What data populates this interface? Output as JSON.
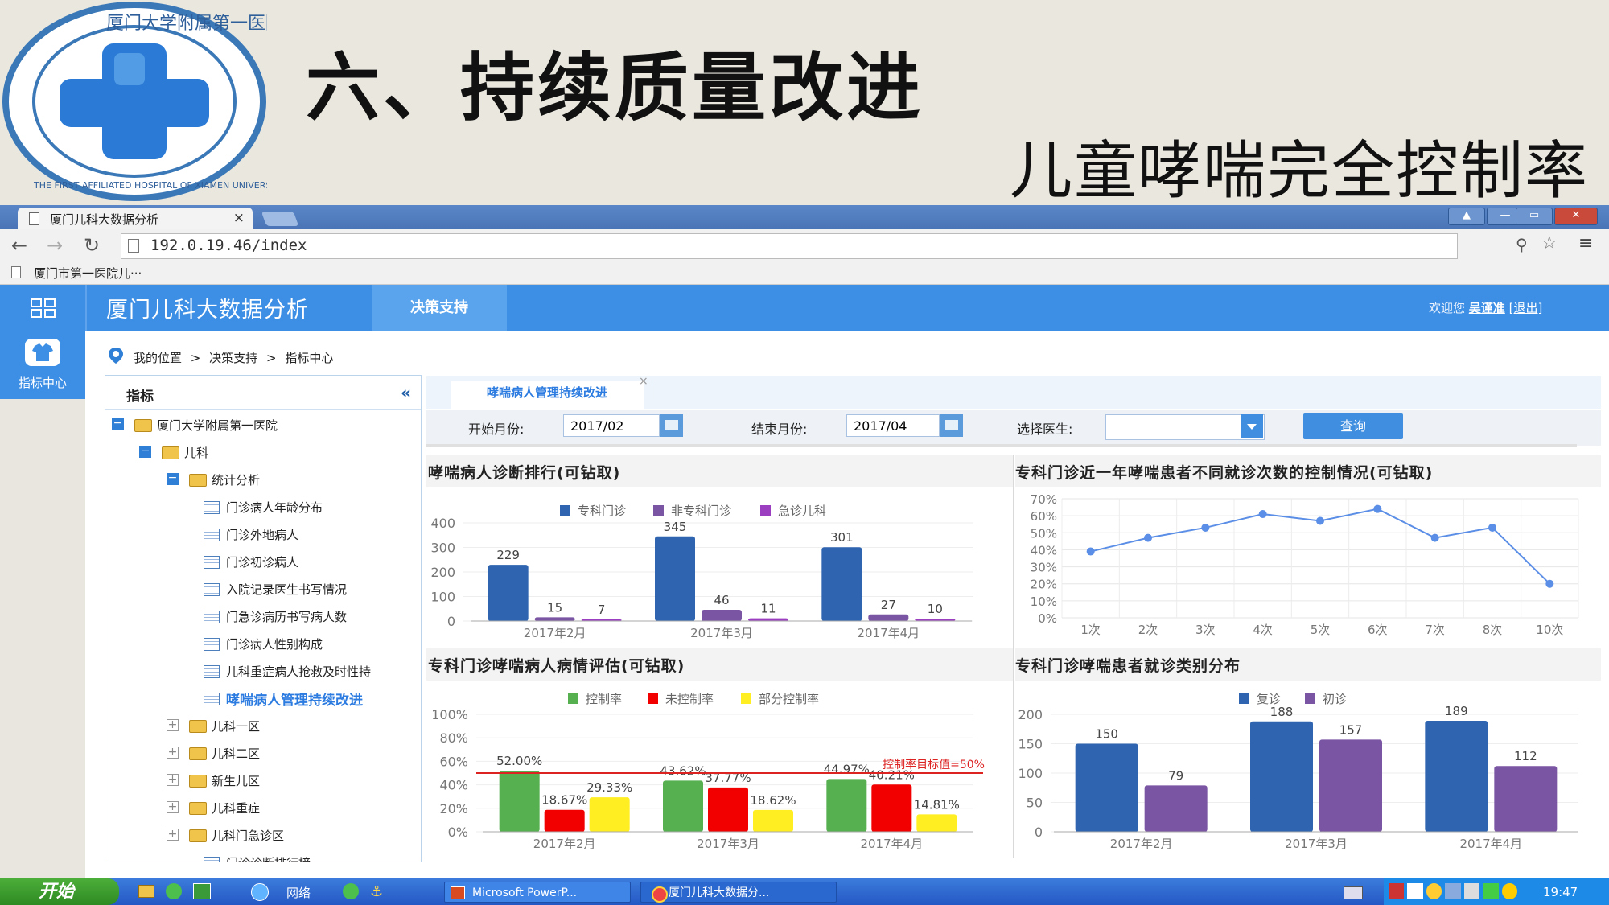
{
  "slide": {
    "title": "六、持续质量改进",
    "subtitle": "儿童哮喘完全控制率",
    "logo_text_top": "厦门大学附属第一医院",
    "logo_text_bottom": "THE FIRST AFFILIATED HOSPITAL OF XIAMEN UNIVERSITY"
  },
  "browser": {
    "tab_title": "厦门儿科大数据分析",
    "tab_close": "×",
    "url": "192.0.19.46/index",
    "bookmark": "厦门市第一医院儿···",
    "window_buttons": [
      "▲",
      "—",
      "▭",
      "✕"
    ]
  },
  "app": {
    "title": "厦门儿科大数据分析",
    "nav_active": "决策支持",
    "welcome": "欢迎您",
    "user": "吴谨准",
    "logout": "[退出]",
    "side_nav_label": "指标中心"
  },
  "breadcrumb": [
    "我的位置",
    ">",
    "决策支持",
    ">",
    "指标中心"
  ],
  "tree": {
    "title": "指标",
    "collapse": "«",
    "items": [
      {
        "label": "厦门大学附属第一医院",
        "type": "folder",
        "toggle": "−"
      },
      {
        "label": "儿科",
        "type": "folder",
        "toggle": "−"
      },
      {
        "label": "统计分析",
        "type": "folder",
        "toggle": "−"
      },
      {
        "label": "门诊病人年龄分布",
        "type": "doc"
      },
      {
        "label": "门诊外地病人",
        "type": "doc"
      },
      {
        "label": "门诊初诊病人",
        "type": "doc"
      },
      {
        "label": "入院记录医生书写情况",
        "type": "doc"
      },
      {
        "label": "门急诊病历书写病人数",
        "type": "doc"
      },
      {
        "label": "门诊病人性别构成",
        "type": "doc"
      },
      {
        "label": "儿科重症病人抢救及时性持",
        "type": "doc"
      },
      {
        "label": "哮喘病人管理持续改进",
        "type": "doc",
        "active": true
      },
      {
        "label": "儿科一区",
        "type": "folder",
        "toggle": "+"
      },
      {
        "label": "儿科二区",
        "type": "folder",
        "toggle": "+"
      },
      {
        "label": "新生儿区",
        "type": "folder",
        "toggle": "+"
      },
      {
        "label": "儿科重症",
        "type": "folder",
        "toggle": "+"
      },
      {
        "label": "儿科门急诊区",
        "type": "folder",
        "toggle": "+"
      },
      {
        "label": "门诊诊断排行榜",
        "type": "doc"
      }
    ]
  },
  "filters": {
    "tab_label": "哮喘病人管理持续改进",
    "tab_close": "×",
    "start_label": "开始月份:",
    "start_value": "2017/02",
    "end_label": "结束月份:",
    "end_value": "2017/04",
    "doctor_label": "选择医生:",
    "doctor_value": "",
    "query_button": "查询"
  },
  "colors": {
    "blue": "#2e64b0",
    "purple": "#7a55a4",
    "violet": "#9b3fc0",
    "green": "#56b050",
    "red": "#f20000",
    "yellow": "#ffee22",
    "line": "#5b8ee6",
    "target": "#dd2222"
  },
  "charts": {
    "c1_title": "哮喘病人诊断排行(可钻取)",
    "c2_title": "专科门诊近一年哮喘患者不同就诊次数的控制情况(可钻取)",
    "c3_title": "专科门诊哮喘病人病情评估(可钻取)",
    "c4_title": "专科门诊哮喘患者就诊类别分布"
  },
  "chart_data": [
    {
      "type": "bar",
      "title": "哮喘病人诊断排行(可钻取)",
      "categories": [
        "2017年2月",
        "2017年3月",
        "2017年4月"
      ],
      "series": [
        {
          "name": "专科门诊",
          "values": [
            229,
            345,
            301
          ],
          "color": "#2e64b0"
        },
        {
          "name": "非专科门诊",
          "values": [
            15,
            46,
            27
          ],
          "color": "#7a55a4"
        },
        {
          "name": "急诊儿科",
          "values": [
            7,
            11,
            10
          ],
          "color": "#9b3fc0"
        }
      ],
      "yticks": [
        "0",
        "100",
        "200",
        "300",
        "400"
      ],
      "ylim": [
        0,
        400
      ],
      "legend": "top"
    },
    {
      "type": "line",
      "title": "专科门诊近一年哮喘患者不同就诊次数的控制情况(可钻取)",
      "categories": [
        "1次",
        "2次",
        "3次",
        "4次",
        "5次",
        "6次",
        "7次",
        "8次",
        "10次"
      ],
      "values": [
        39,
        47,
        53,
        61,
        57,
        64,
        47,
        53,
        20
      ],
      "yticks": [
        "0%",
        "10%",
        "20%",
        "30%",
        "40%",
        "50%",
        "60%",
        "70%"
      ],
      "ylim": [
        0,
        70
      ],
      "grid": true
    },
    {
      "type": "bar",
      "title": "专科门诊哮喘病人病情评估(可钻取)",
      "categories": [
        "2017年3月",
        "2017年3月",
        "2017年4月"
      ],
      "category_labels": [
        "2017年2月",
        "2017年3月",
        "2017年4月"
      ],
      "series": [
        {
          "name": "控制率",
          "values": [
            52.0,
            43.62,
            44.97
          ],
          "labels": [
            "52.00%",
            "43.62%",
            "44.97%"
          ],
          "color": "#56b050"
        },
        {
          "name": "未控制率",
          "values": [
            18.67,
            37.77,
            40.21
          ],
          "labels": [
            "18.67%",
            "37.77%",
            "40.21%"
          ],
          "color": "#f20000"
        },
        {
          "name": "部分控制率",
          "values": [
            29.33,
            18.62,
            14.81
          ],
          "labels": [
            "29.33%",
            "18.62%",
            "14.81%"
          ],
          "color": "#ffee22"
        }
      ],
      "yticks": [
        "0%",
        "20%",
        "40%",
        "60%",
        "80%",
        "100%"
      ],
      "ylim": [
        0,
        100
      ],
      "target_value": 50,
      "target_label": "控制率目标值=50%",
      "legend": "top"
    },
    {
      "type": "bar",
      "title": "专科门诊哮喘患者就诊类别分布",
      "categories": [
        "2017年2月",
        "2017年3月",
        "2017年4月"
      ],
      "series": [
        {
          "name": "复诊",
          "values": [
            150,
            188,
            189
          ],
          "color": "#2e64b0"
        },
        {
          "name": "初诊",
          "values": [
            79,
            157,
            112
          ],
          "color": "#7a55a4"
        }
      ],
      "yticks": [
        "0",
        "50",
        "100",
        "150",
        "200"
      ],
      "ylim": [
        0,
        200
      ],
      "legend": "top"
    }
  ],
  "taskbar": {
    "start": "开始",
    "network": "网络",
    "tasks": [
      "Microsoft PowerP...",
      "厦门儿科大数据分..."
    ],
    "clock": "19:47"
  }
}
